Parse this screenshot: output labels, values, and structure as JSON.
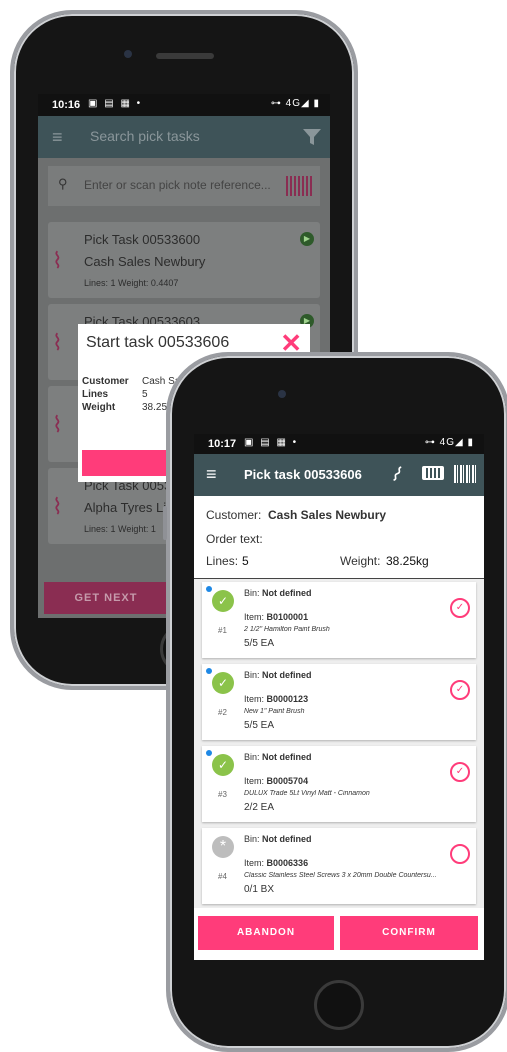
{
  "back_phone": {
    "status": {
      "time": "10:16",
      "icons": "▣ ▤ ▦ •",
      "right": "⊶ 4G◢ ▮"
    },
    "topbar": {
      "title": "Search pick tasks",
      "menu_icon": "menu-icon",
      "filter_icon": "filter-icon"
    },
    "search": {
      "placeholder": "Enter or scan pick note reference..."
    },
    "cards": [
      {
        "title": "Pick Task 00533600",
        "customer": "Cash Sales Newbury",
        "meta": "Lines: 1    Weight: 0.4407"
      },
      {
        "title": "Pick Task 00533603",
        "customer": "",
        "meta": ""
      },
      {
        "title": "Pick Task 0053",
        "customer": "Alpha Tyres Lin",
        "meta": "Lines: 1    Weight: 1"
      }
    ],
    "modal": {
      "title": "Start task 00533606",
      "customer_label": "Customer",
      "customer_value": "Cash Sales N",
      "lines_label": "Lines",
      "lines_value": "5",
      "weight_label": "Weight",
      "weight_value": "38.25"
    },
    "get_next_label": "GET NEXT"
  },
  "front_phone": {
    "status": {
      "time": "10:17",
      "icons": "▣ ▤ ▦ •",
      "right": "⊶ 4G◢ ▮"
    },
    "topbar": {
      "title": "Pick task 00533606"
    },
    "summary": {
      "customer_label": "Customer:",
      "customer_value": "Cash Sales Newbury",
      "order_text_label": "Order text:",
      "lines_label": "Lines:",
      "lines_value": "5",
      "weight_label": "Weight:",
      "weight_value": "38.25kg"
    },
    "lines": [
      {
        "num": "#1",
        "bin_label": "Bin:",
        "bin": "Not defined",
        "item_label": "Item:",
        "item": "B0100001",
        "desc": "2 1/2\" Hamilton Paint Brush",
        "qty": "5/5 EA",
        "done": true
      },
      {
        "num": "#2",
        "bin_label": "Bin:",
        "bin": "Not defined",
        "item_label": "Item:",
        "item": "B0000123",
        "desc": "New 1\" Paint Brush",
        "qty": "5/5 EA",
        "done": true
      },
      {
        "num": "#3",
        "bin_label": "Bin:",
        "bin": "Not defined",
        "item_label": "Item:",
        "item": "B0005704",
        "desc": "DULUX Trade 5Lt Vinyl Matt - Cinnamon",
        "qty": "2/2 EA",
        "done": true
      },
      {
        "num": "#4",
        "bin_label": "Bin:",
        "bin": "Not defined",
        "item_label": "Item:",
        "item": "B0006336",
        "desc": "Classic Stainless Steel Screws 3 x 20mm Double Countersu...",
        "qty": "0/1 BX",
        "done": false
      }
    ],
    "abandon_label": "ABANDON",
    "confirm_label": "CONFIRM"
  },
  "colors": {
    "accent": "#ff3c7a",
    "header": "#3e5358",
    "done_green": "#8bc34a"
  }
}
